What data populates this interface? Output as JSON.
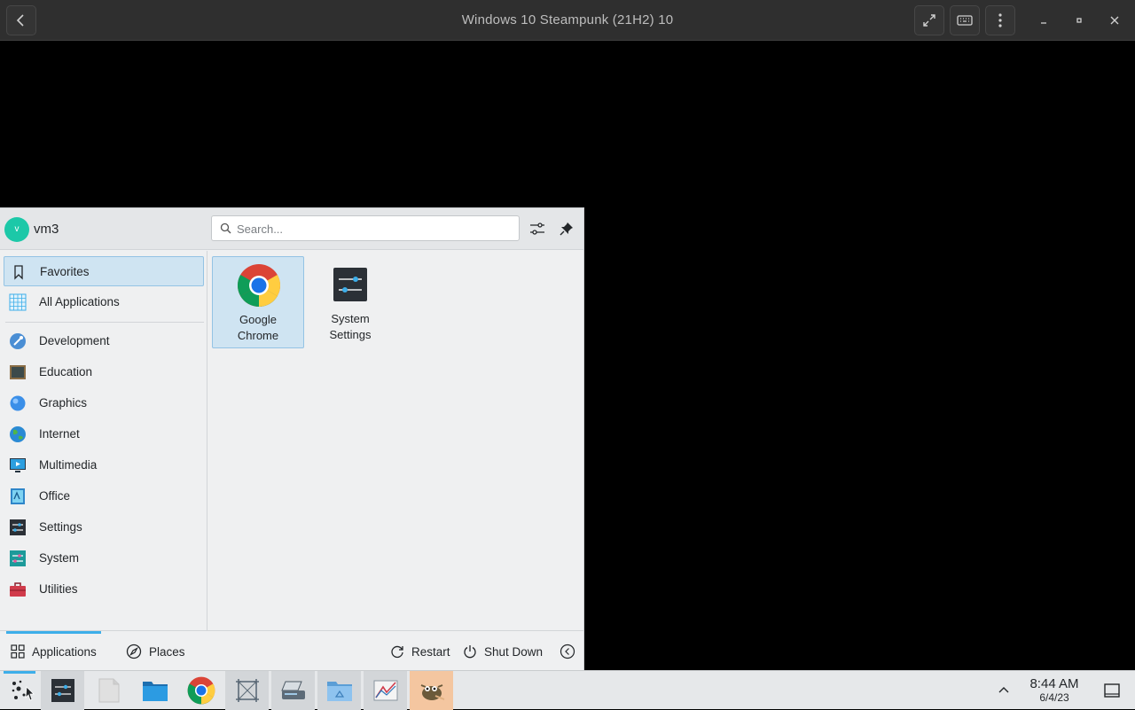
{
  "viewer": {
    "title": "Windows 10 Steampunk (21H2) 10",
    "buttons": [
      "back",
      "fullscreen",
      "keyboard",
      "menu"
    ],
    "window_controls": [
      "minimize",
      "maximize",
      "close"
    ]
  },
  "launcher": {
    "user": {
      "initial": "v",
      "name": "vm3",
      "avatar_color": "#1cc8a8"
    },
    "search": {
      "placeholder": "Search...",
      "value": ""
    },
    "categories": [
      {
        "label": "Favorites",
        "icon": "bookmark-icon",
        "selected": true
      },
      {
        "label": "All Applications",
        "icon": "grid-icon",
        "selected": false
      },
      {
        "label": "Development",
        "icon": "development-icon",
        "selected": false
      },
      {
        "label": "Education",
        "icon": "education-icon",
        "selected": false
      },
      {
        "label": "Graphics",
        "icon": "graphics-icon",
        "selected": false
      },
      {
        "label": "Internet",
        "icon": "internet-icon",
        "selected": false
      },
      {
        "label": "Multimedia",
        "icon": "multimedia-icon",
        "selected": false
      },
      {
        "label": "Office",
        "icon": "office-icon",
        "selected": false
      },
      {
        "label": "Settings",
        "icon": "settings-icon",
        "selected": false
      },
      {
        "label": "System",
        "icon": "system-icon",
        "selected": false
      },
      {
        "label": "Utilities",
        "icon": "utilities-icon",
        "selected": false
      }
    ],
    "favorites": [
      {
        "label": "Google Chrome",
        "line1": "Google",
        "line2": "Chrome",
        "icon": "chrome-icon",
        "selected": true
      },
      {
        "label": "System Settings",
        "line1": "System",
        "line2": "Settings",
        "icon": "system-settings-icon",
        "selected": false
      }
    ],
    "footer": {
      "applications": "Applications",
      "places": "Places",
      "restart": "Restart",
      "shutdown": "Shut Down"
    }
  },
  "taskbar": {
    "items": [
      "launcher-icon",
      "system-settings-icon",
      "blank-file-icon",
      "folder-icon",
      "chrome-icon",
      "screenshot-icon",
      "scanner-icon",
      "network-folder-icon",
      "chart-app-icon",
      "gimp-icon"
    ],
    "clock": {
      "time": "8:44 AM",
      "date": "6/4/23"
    }
  },
  "colors": {
    "accent": "#3daee9",
    "selection": "#cfe4f2",
    "taskbar_highlight": "#f4c6a0"
  }
}
